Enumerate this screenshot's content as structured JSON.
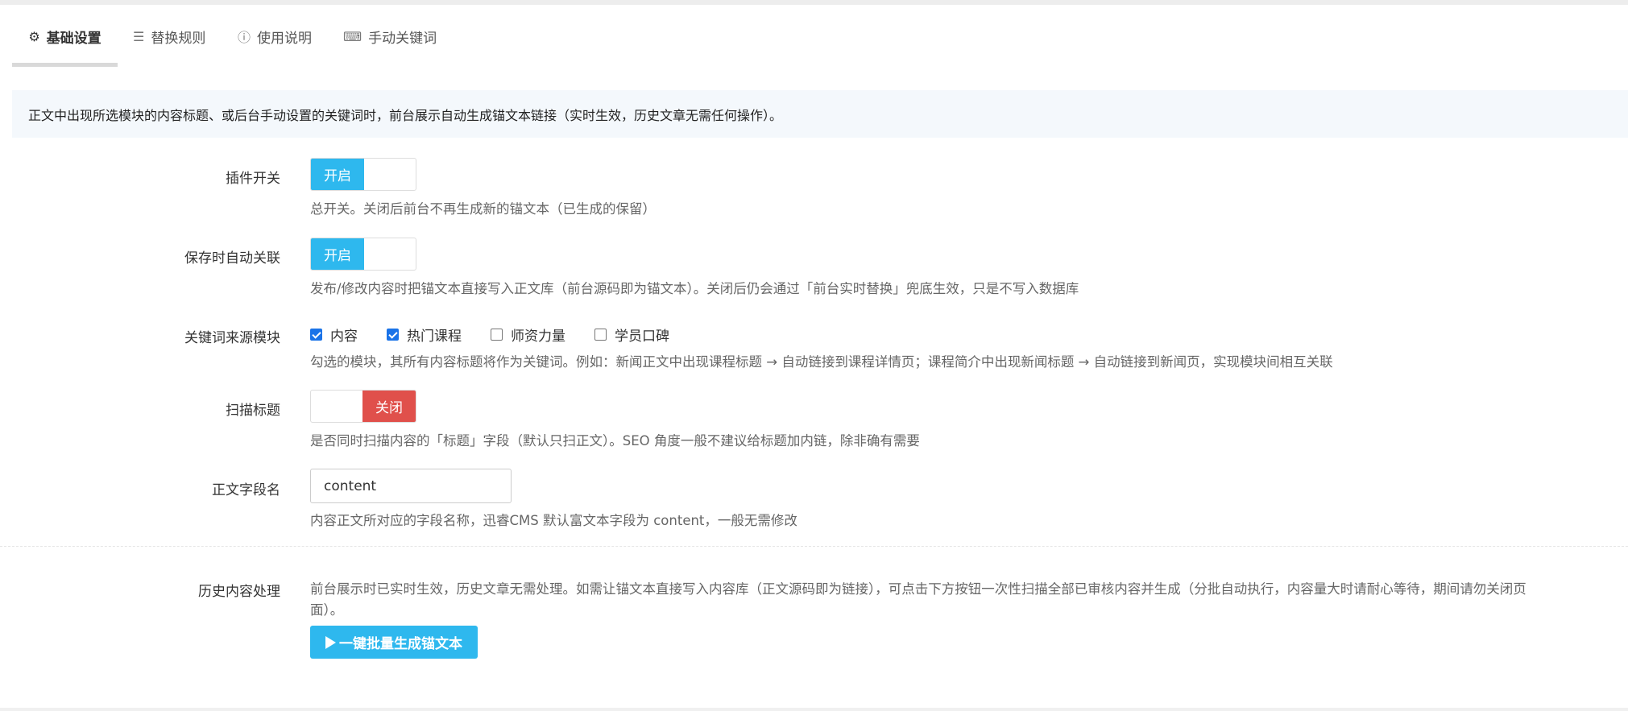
{
  "tabs": [
    {
      "label": "基础设置",
      "icon": "gear-icon",
      "glyph": "⚙",
      "active": true
    },
    {
      "label": "替换规则",
      "icon": "sliders-icon",
      "glyph": "☰",
      "active": false
    },
    {
      "label": "使用说明",
      "icon": "info-icon",
      "glyph": "ⓘ",
      "active": false
    },
    {
      "label": "手动关键词",
      "icon": "keyboard-icon",
      "glyph": "⌨",
      "active": false
    }
  ],
  "notice": "正文中出现所选模块的内容标题、或后台手动设置的关键词时，前台展示自动生成锚文本链接（实时生效，历史文章无需任何操作）。",
  "plugin_switch": {
    "label": "插件开关",
    "state": "开启",
    "on": true,
    "help": "总开关。关闭后前台不再生成新的锚文本（已生成的保留）"
  },
  "auto_link_on_save": {
    "label": "保存时自动关联",
    "state": "开启",
    "on": true,
    "help": "发布/修改内容时把锚文本直接写入正文库（前台源码即为锚文本）。关闭后仍会通过「前台实时替换」兜底生效，只是不写入数据库"
  },
  "keyword_source": {
    "label": "关键词来源模块",
    "options": [
      {
        "label": "内容",
        "checked": true
      },
      {
        "label": "热门课程",
        "checked": true
      },
      {
        "label": "师资力量",
        "checked": false
      },
      {
        "label": "学员口碑",
        "checked": false
      }
    ],
    "help": "勾选的模块，其所有内容标题将作为关键词。例如：新闻正文中出现课程标题 → 自动链接到课程详情页；课程简介中出现新闻标题 → 自动链接到新闻页，实现模块间相互关联"
  },
  "scan_title": {
    "label": "扫描标题",
    "state": "关闭",
    "on": false,
    "help": "是否同时扫描内容的「标题」字段（默认只扫正文）。SEO 角度一般不建议给标题加内链，除非确有需要"
  },
  "body_field": {
    "label": "正文字段名",
    "value": "content",
    "help": "内容正文所对应的字段名称，迅睿CMS 默认富文本字段为 content，一般无需修改"
  },
  "history": {
    "label": "历史内容处理",
    "help_line1": "前台展示时已实时生效，历史文章无需处理。如需让锚文本直接写入内容库（正文源码即为链接），可点击下方按钮一次性扫描全部已审核内容并生成（分批自动执行，内容量大时请耐心等待，期间请勿关闭页",
    "help_line2": "面）。",
    "button_label": "一键批量生成锚文本"
  },
  "colors": {
    "switch_on": "#2eb8ee",
    "switch_off": "#e0504b",
    "button": "#2eb8ee",
    "notice_bg": "#f4f8fc"
  }
}
